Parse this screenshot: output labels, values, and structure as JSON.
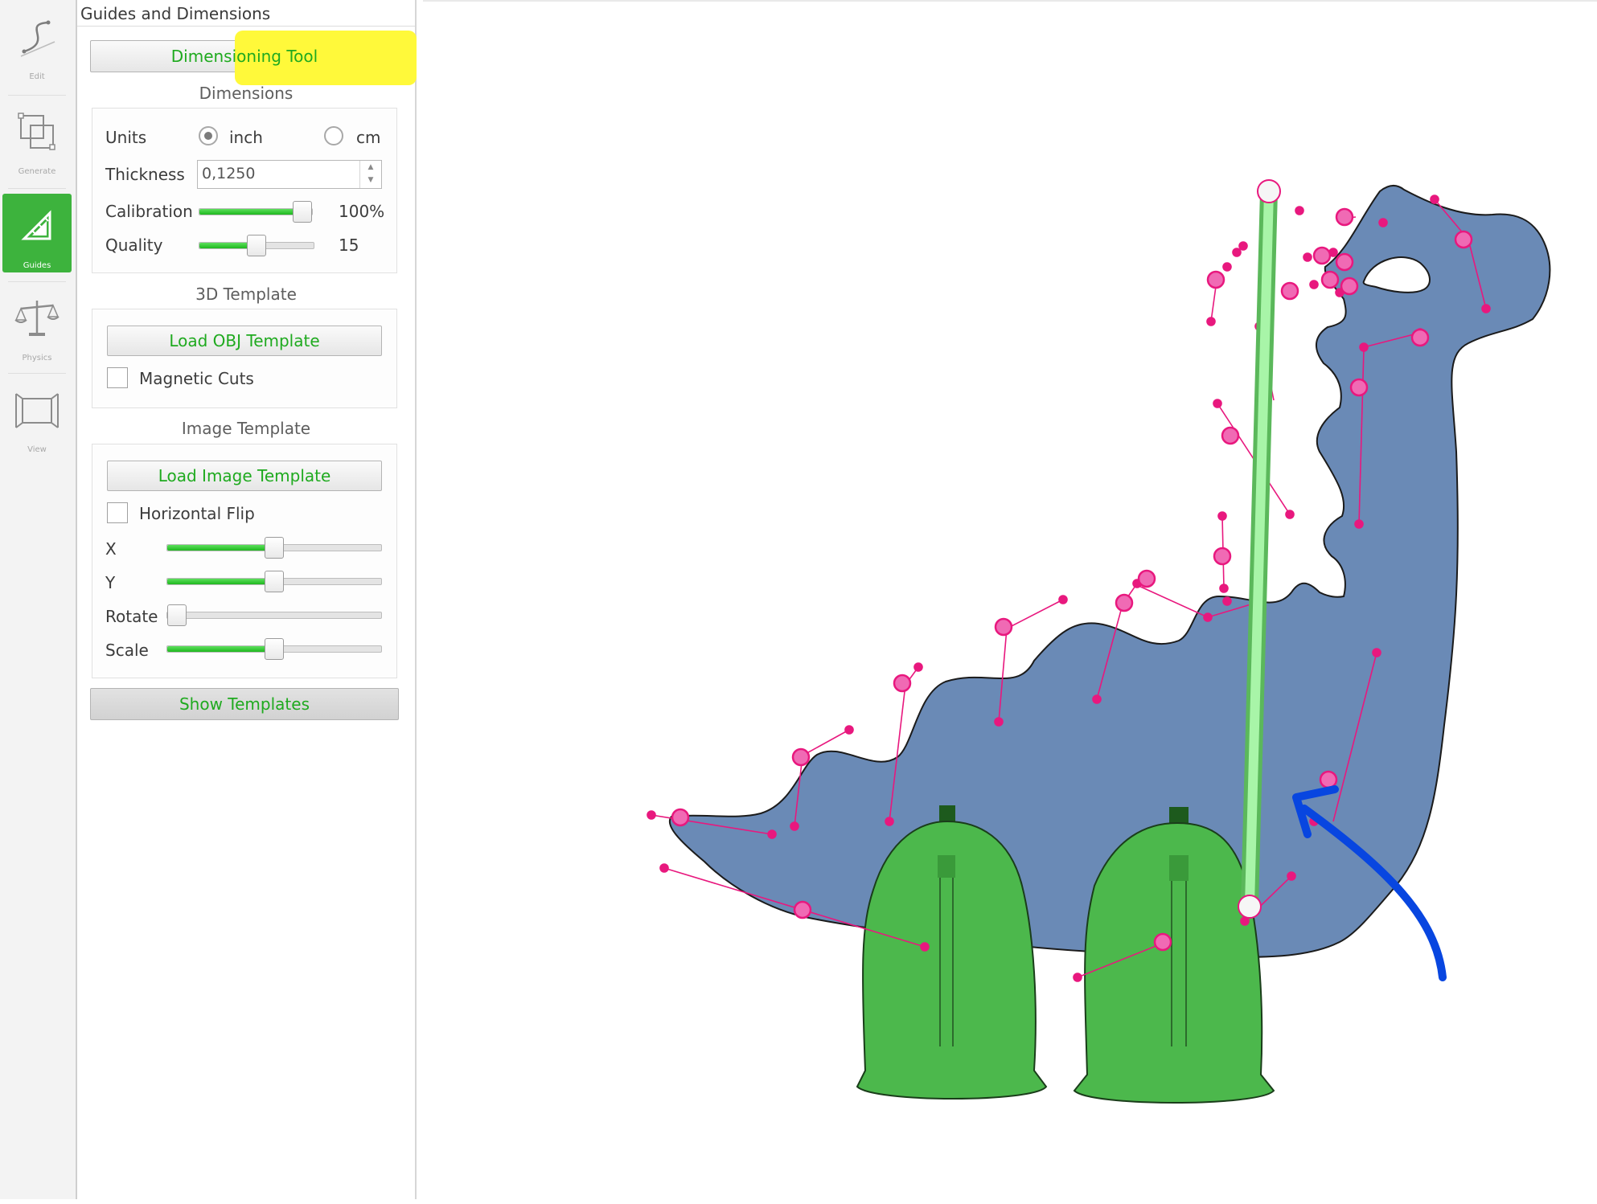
{
  "rail": {
    "items": [
      {
        "label": "Edit",
        "icon": "edit-curve-icon"
      },
      {
        "label": "Generate",
        "icon": "generate-icon"
      },
      {
        "label": "Guides",
        "icon": "guides-ruler-icon"
      },
      {
        "label": "Physics",
        "icon": "balance-scale-icon"
      },
      {
        "label": "View",
        "icon": "view-icon"
      }
    ]
  },
  "panel": {
    "title": "Guides and Dimensions",
    "dimensioning_tool_label": "Dimensioning Tool",
    "dimensions": {
      "heading": "Dimensions",
      "units_label": "Units",
      "unit_inch": "inch",
      "unit_cm": "cm",
      "selected_unit": "inch",
      "thickness_label": "Thickness",
      "thickness_value": "0,1250",
      "calibration_label": "Calibration",
      "calibration_value": "100%",
      "calibration_level": 1.0,
      "quality_label": "Quality",
      "quality_value": "15",
      "quality_level": 0.5
    },
    "template_3d": {
      "heading": "3D Template",
      "load_label": "Load OBJ Template",
      "magnetic_cuts_label": "Magnetic Cuts",
      "magnetic_cuts_checked": false
    },
    "image_template": {
      "heading": "Image Template",
      "load_label": "Load Image Template",
      "horizontal_flip_label": "Horizontal Flip",
      "horizontal_flip_checked": false,
      "x_label": "X",
      "x_level": 0.5,
      "y_label": "Y",
      "y_level": 0.5,
      "rotate_label": "Rotate",
      "rotate_level": 0.0,
      "scale_label": "Scale",
      "scale_level": 0.5
    },
    "show_templates_label": "Show Templates"
  },
  "colors": {
    "accent_green": "#3db33d",
    "button_text_green": "#1faa1f",
    "highlight_yellow": "#fff93a",
    "body_blue": "#6a8ab6",
    "legs_green": "#4cb84c",
    "control_pink": "#f06ab4",
    "handle_magenta": "#e8187e",
    "guide_green": "#9df09d",
    "arrow_blue": "#0846e0"
  }
}
